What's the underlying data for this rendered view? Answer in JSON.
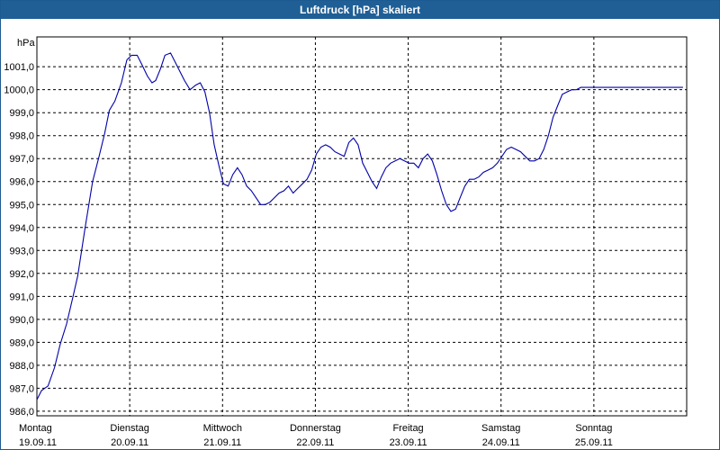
{
  "window": {
    "title": "Luftdruck [hPa] skaliert"
  },
  "colors": {
    "title_bar": "#1f5f96",
    "line": "#0000a8",
    "grid": "#000000"
  },
  "chart_data": {
    "type": "line",
    "title": "Luftdruck [hPa] skaliert",
    "ylabel": "hPa",
    "xlabel": "",
    "grid": true,
    "grid_style": "dashed",
    "ylim": [
      985.8,
      1002.3
    ],
    "xlim": [
      0,
      7.0
    ],
    "y_ticks": [
      {
        "value": 986.0,
        "label": "986,0"
      },
      {
        "value": 987.0,
        "label": "987,0"
      },
      {
        "value": 988.0,
        "label": "988,0"
      },
      {
        "value": 989.0,
        "label": "989,0"
      },
      {
        "value": 990.0,
        "label": "990,0"
      },
      {
        "value": 991.0,
        "label": "991,0"
      },
      {
        "value": 992.0,
        "label": "992,0"
      },
      {
        "value": 993.0,
        "label": "993,0"
      },
      {
        "value": 994.0,
        "label": "994,0"
      },
      {
        "value": 995.0,
        "label": "995,0"
      },
      {
        "value": 996.0,
        "label": "996,0"
      },
      {
        "value": 997.0,
        "label": "997,0"
      },
      {
        "value": 998.0,
        "label": "998,0"
      },
      {
        "value": 999.0,
        "label": "999,0"
      },
      {
        "value": 1000.0,
        "label": "1000,0"
      },
      {
        "value": 1001.0,
        "label": "1001,0"
      }
    ],
    "x_ticks": [
      {
        "value": 1.0,
        "day": "Dienstag",
        "date": "20.09.11"
      },
      {
        "value": 2.0,
        "day": "Mittwoch",
        "date": "21.09.11"
      },
      {
        "value": 3.0,
        "day": "Donnerstag",
        "date": "22.09.11"
      },
      {
        "value": 4.0,
        "day": "Freitag",
        "date": "23.09.11"
      },
      {
        "value": 5.0,
        "day": "Samstag",
        "date": "24.09.11"
      },
      {
        "value": 6.0,
        "day": "Sonntag",
        "date": "25.09.11"
      }
    ],
    "x_start_label": {
      "day": "Montag",
      "date": "19.09.11"
    },
    "series": [
      {
        "name": "",
        "x": [
          0.0,
          0.05,
          0.12,
          0.19,
          0.25,
          0.32,
          0.39,
          0.44,
          0.52,
          0.6,
          0.67,
          0.73,
          0.78,
          0.84,
          0.91,
          0.97,
          1.02,
          1.08,
          1.13,
          1.19,
          1.24,
          1.28,
          1.33,
          1.38,
          1.44,
          1.49,
          1.54,
          1.59,
          1.65,
          1.71,
          1.76,
          1.81,
          1.86,
          1.91,
          1.96,
          2.01,
          2.06,
          2.11,
          2.16,
          2.21,
          2.26,
          2.31,
          2.36,
          2.41,
          2.46,
          2.51,
          2.56,
          2.61,
          2.66,
          2.71,
          2.76,
          2.81,
          2.86,
          2.91,
          2.96,
          3.01,
          3.06,
          3.11,
          3.16,
          3.21,
          3.26,
          3.31,
          3.36,
          3.41,
          3.46,
          3.51,
          3.56,
          3.61,
          3.66,
          3.71,
          3.76,
          3.81,
          3.86,
          3.91,
          3.96,
          4.01,
          4.06,
          4.11,
          4.16,
          4.21,
          4.26,
          4.31,
          4.36,
          4.41,
          4.46,
          4.51,
          4.56,
          4.61,
          4.66,
          4.71,
          4.76,
          4.81,
          4.86,
          4.91,
          4.96,
          5.01,
          5.06,
          5.11,
          5.16,
          5.21,
          5.26,
          5.31,
          5.36,
          5.41,
          5.46,
          5.51,
          5.56,
          5.61,
          5.66,
          5.71,
          5.76,
          5.81,
          5.86,
          5.91,
          5.96,
          6.01,
          6.06,
          6.11,
          6.16,
          6.21,
          6.26,
          6.31,
          6.36,
          6.41,
          6.46,
          6.51,
          6.56,
          6.61,
          6.66,
          6.71,
          6.76,
          6.81,
          6.86,
          6.91,
          6.96
        ],
        "values": [
          986.5,
          986.9,
          987.1,
          987.9,
          988.9,
          989.8,
          991.0,
          991.9,
          994.0,
          996.0,
          997.1,
          998.1,
          999.1,
          999.5,
          1000.3,
          1001.3,
          1001.5,
          1001.5,
          1001.1,
          1000.6,
          1000.3,
          1000.4,
          1000.9,
          1001.5,
          1001.6,
          1001.2,
          1000.8,
          1000.4,
          1000.0,
          1000.2,
          1000.3,
          999.9,
          999.0,
          997.6,
          996.7,
          995.9,
          995.8,
          996.3,
          996.6,
          996.3,
          995.8,
          995.6,
          995.3,
          995.0,
          995.0,
          995.1,
          995.3,
          995.5,
          995.6,
          995.8,
          995.5,
          995.7,
          995.9,
          996.1,
          996.5,
          997.2,
          997.5,
          997.6,
          997.5,
          997.3,
          997.2,
          997.1,
          997.7,
          997.9,
          997.6,
          996.8,
          996.4,
          996.0,
          995.7,
          996.2,
          996.6,
          996.8,
          996.9,
          997.0,
          996.9,
          996.8,
          996.8,
          996.6,
          997.0,
          997.2,
          996.9,
          996.3,
          995.6,
          995.0,
          994.7,
          994.8,
          995.3,
          995.8,
          996.1,
          996.1,
          996.2,
          996.4,
          996.5,
          996.6,
          996.8,
          997.1,
          997.4,
          997.5,
          997.4,
          997.3,
          997.1,
          996.9,
          996.9,
          997.0,
          997.4,
          998.0,
          998.8,
          999.3,
          999.8,
          999.9,
          1000.0,
          1000.0,
          1000.1,
          1000.1,
          1000.1,
          1000.1,
          1000.1,
          1000.1,
          1000.1,
          1000.1,
          1000.1,
          1000.1,
          1000.1,
          1000.1,
          1000.1,
          1000.1,
          1000.1,
          1000.1,
          1000.1,
          1000.1,
          1000.1,
          1000.1,
          1000.1,
          1000.1,
          1000.1
        ]
      }
    ]
  }
}
